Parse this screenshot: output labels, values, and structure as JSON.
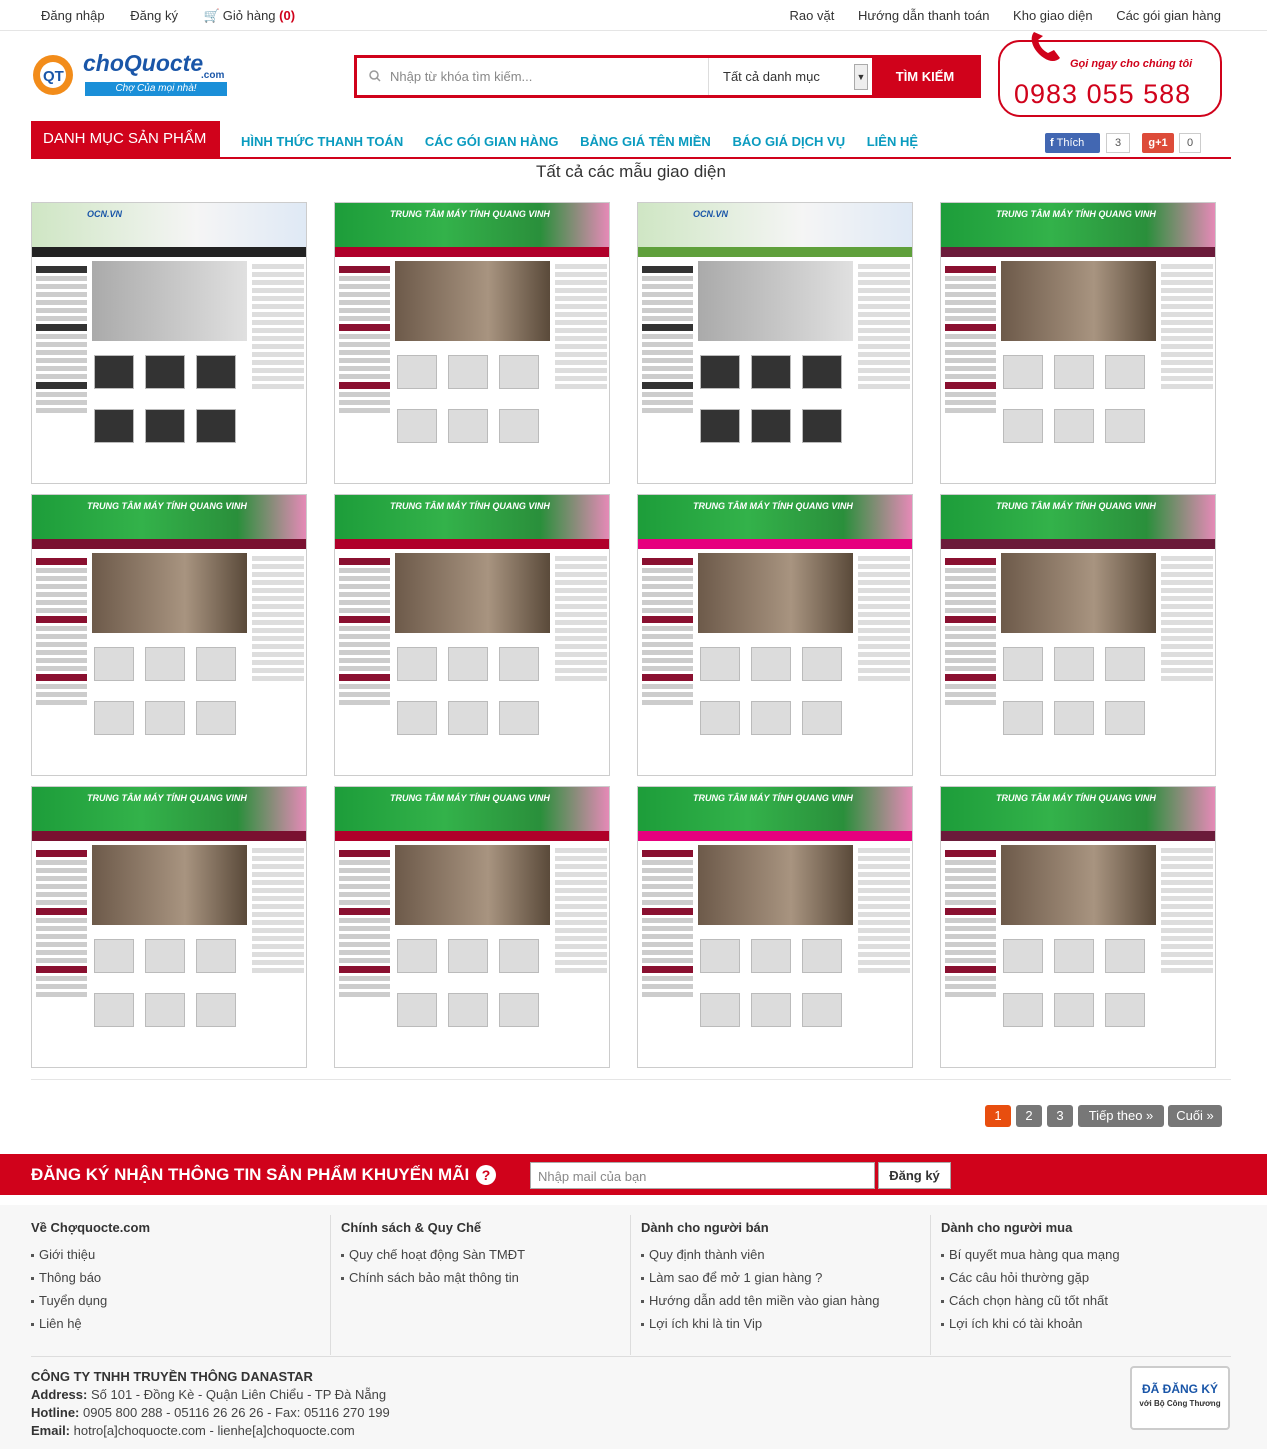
{
  "topbar": {
    "login": "Đăng nhập",
    "register": "Đăng ký",
    "cart_label": "Giỏ hàng",
    "cart_count": "(0)",
    "right_links": [
      "Rao vặt",
      "Hướng dẫn thanh toán",
      "Kho giao diện",
      "Các gói gian hàng"
    ]
  },
  "logo": {
    "name": "choQuocte",
    "com": ".com",
    "slogan": "Chợ Của mọi nhà!"
  },
  "search": {
    "placeholder": "Nhập từ khóa tìm kiếm...",
    "category": "Tất cả danh mục",
    "button": "TÌM KIẾM"
  },
  "hotline": {
    "label": "Gọi ngay cho chúng tôi",
    "number": "0983 055 588"
  },
  "nav": {
    "category_button": "DANH MỤC SẢN PHẨM",
    "links": [
      "HÌNH THỨC THANH TOÁN",
      "CÁC GÓI GIAN HÀNG",
      "BẢNG GIÁ TÊN MIỀN",
      "BÁO GIÁ DỊCH VỤ",
      "LIÊN HỆ"
    ],
    "fb_label": "Thích",
    "fb_count": "3",
    "gplus_label": "g+1",
    "gplus_count": "0"
  },
  "page_title": "Tất cả các mẫu giao diện",
  "pagination": [
    "1",
    "2",
    "3",
    "Tiếp theo »",
    "Cuối »"
  ],
  "newsletter": {
    "title": "ĐĂNG KÝ NHẬN THÔNG TIN SẢN PHẨM KHUYẾN MÃI",
    "help": "?",
    "placeholder": "Nhập mail của bạn",
    "button": "Đăng ký"
  },
  "footer": {
    "columns": [
      {
        "title": "Về Chợquocte.com",
        "items": [
          "Giới thiệu",
          "Thông báo",
          "Tuyển dụng",
          "Liên hệ"
        ]
      },
      {
        "title": "Chính sách & Quy Chế",
        "items": [
          "Quy chế hoạt động Sàn TMĐT",
          "Chính sách bảo mật thông tin"
        ]
      },
      {
        "title": "Dành cho người bán",
        "items": [
          "Quy định thành viên",
          "Làm sao để mở 1 gian hàng ?",
          "Hướng dẫn add tên miền vào gian hàng",
          "Lợi ích khi là tin Vip"
        ]
      },
      {
        "title": "Dành cho người mua",
        "items": [
          "Bí quyết mua hàng qua mạng",
          "Các câu hỏi thường gặp",
          "Cách chọn hàng cũ tốt nhất",
          "Lợi ích khi có tài khoản"
        ]
      }
    ],
    "company": "CÔNG TY TNHH TRUYỀN THÔNG DANASTAR",
    "address_label": "Address:",
    "address": "Số 101 - Đồng Kè - Quận Liên Chiểu - TP Đà Nẵng",
    "hotline_label": "Hotline:",
    "hotline": "0905 800 288 - 05116 26 26 26 - Fax: 05116 270 199",
    "email_label": "Email:",
    "email": "hotro[a]choquocte.com - lienhe[a]choquocte.com",
    "badge_main": "ĐÃ ĐĂNG KÝ",
    "badge_sub": "với Bộ Công Thương"
  },
  "templates": [
    {
      "theme": "ocn",
      "title": "OCN.VN"
    },
    {
      "theme": "qv",
      "title": "TRUNG TÂM MÁY TÍNH QUANG VINH"
    },
    {
      "theme": "ocn",
      "title": "OCN.VN"
    },
    {
      "theme": "qv",
      "title": "TRUNG TÂM MÁY TÍNH QUANG VINH"
    },
    {
      "theme": "qv",
      "title": "TRUNG TÂM MÁY TÍNH QUANG VINH"
    },
    {
      "theme": "qv",
      "title": "TRUNG TÂM MÁY TÍNH QUANG VINH"
    },
    {
      "theme": "qv",
      "title": "TRUNG TÂM MÁY TÍNH QUANG VINH"
    },
    {
      "theme": "qv",
      "title": "TRUNG TÂM MÁY TÍNH QUANG VINH"
    },
    {
      "theme": "qv",
      "title": "TRUNG TÂM MÁY TÍNH QUANG VINH"
    },
    {
      "theme": "qv",
      "title": "TRUNG TÂM MÁY TÍNH QUANG VINH"
    },
    {
      "theme": "qv",
      "title": "TRUNG TÂM MÁY TÍNH QUANG VINH"
    },
    {
      "theme": "qv",
      "title": "TRUNG TÂM MÁY TÍNH QUANG VINH"
    }
  ],
  "colors": {
    "accent": "#d0021b",
    "nav_link": "#0a9bbf"
  }
}
